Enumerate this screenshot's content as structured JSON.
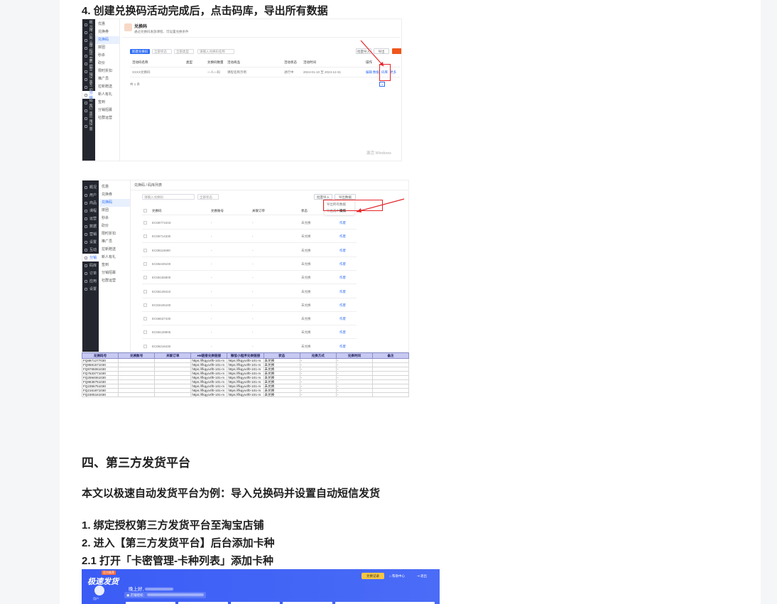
{
  "step4": "4. 创建兑换码活动完成后，点击码库，导出所有数据",
  "section4": "四、第三方发货平台",
  "intro": "本文以极速自动发货平台为例：导入兑换码并设置自动短信发货",
  "step1": "1. 绑定授权第三方发货平台至淘宝店铺",
  "step2": "2. 进入【第三方发货平台】后台添加卡种",
  "step21": "2.1 打开「卡密管理-卡种列表」添加卡种",
  "shot1": {
    "nav": [
      "概况",
      "用户",
      "商品",
      "课程",
      "运营",
      "数据",
      "营销",
      "设置",
      "互动",
      "分销",
      "码库",
      "订单",
      "应用",
      "设置"
    ],
    "sub": [
      "优惠",
      "兑换券",
      "兑换码",
      "拼团",
      "秒杀",
      "砍价",
      "限时折扣",
      "推广员",
      "拉新赠送",
      "新人有礼",
      "签到",
      "分销招募",
      "社群运营"
    ],
    "title": "兑换码",
    "desc": "通过兑换码发放课程、可设置兑换条件",
    "create": "新建兑换码",
    "filter1": "全部状态",
    "filter2": "全部类型",
    "search": "请输入兑换码名称",
    "btn_a": "批量导入",
    "btn_b": "导出",
    "cols": [
      "活动码名称",
      "类型",
      "兑换码数量",
      "活动商品",
      "活动状态",
      "活动时间",
      "操作"
    ],
    "row": [
      "XXXX兑换码",
      "",
      "一人一码",
      "课程名称示例",
      "进行中",
      "2024-01-10 至 2024-12-31"
    ],
    "ops": [
      "编辑",
      "数据",
      "码库",
      "更多"
    ],
    "pager": "共 1 条",
    "watermark": "激活 Windows"
  },
  "shot2": {
    "nav": [
      "概况",
      "用户",
      "商品",
      "课程",
      "运营",
      "数据",
      "营销",
      "设置",
      "互动",
      "分销",
      "码库",
      "订单",
      "应用",
      "设置"
    ],
    "sub": [
      "优惠",
      "兑换券",
      "兑换码",
      "拼团",
      "秒杀",
      "砍价",
      "限时折扣",
      "推广员",
      "拉新赠送",
      "新人有礼",
      "签到",
      "分销招募",
      "社群运营"
    ],
    "breadcrumb": "兑换码 / 码库列表",
    "search": "请输入兑换码",
    "status": "全部状态",
    "btn_import": "批量导入",
    "btn_export": "导出数据",
    "menu1": "导出所有数据",
    "menu2": "导出选中数据",
    "cols": [
      "兑换码",
      "兑换账号",
      "关联订单",
      "状态",
      "操作"
    ],
    "codes": [
      "EC88771043",
      "EC85714330",
      "EC88116590",
      "EC86449100",
      "EC85155800",
      "EC85139410",
      "EC83446100",
      "EC86537430",
      "EC86128905",
      "EC86218430"
    ],
    "state": "未兑换",
    "op": "作废"
  },
  "excel": {
    "head": [
      "兑换码号",
      "兑换账号",
      "关联订单",
      "H5链接兑换链接",
      "微信小程序兑换链接",
      "状态",
      "兑换方式",
      "兑换时间",
      "备注"
    ],
    "rows": [
      [
        "FQ8871277030",
        "",
        "",
        "https://fkqyo4f0-101-m",
        "https://fkqyo4f0-101-m",
        "未兑换",
        "-",
        "-",
        ""
      ],
      [
        "FQ8581571030",
        "",
        "",
        "https://fkqyo4f0-101-m",
        "https://fkqyo4f0-101-m",
        "未兑换",
        "-",
        "-",
        ""
      ],
      [
        "FQ8765061030",
        "",
        "",
        "https://fkqyo4f0-101-m",
        "https://fkqyo4f0-101-m",
        "未兑换",
        "-",
        "-",
        ""
      ],
      [
        "FQ7533771030",
        "",
        "",
        "https://fkqyo4f0-101-m",
        "https://fkqyo4f0-101-m",
        "未兑换",
        "-",
        "-",
        ""
      ],
      [
        "FQ2594061030",
        "",
        "",
        "https://fkqyo4f0-101-m",
        "https://fkqyo4f0-101-m",
        "未兑换",
        "-",
        "-",
        ""
      ],
      [
        "FQ8638751030",
        "",
        "",
        "https://fkqyo4f0-101-m",
        "https://fkqyo4f0-101-m",
        "未兑换",
        "-",
        "-",
        ""
      ],
      [
        "FQ2356751030",
        "",
        "",
        "https://fkqyo4f0-101-m",
        "https://fkqyo4f0-101-m",
        "未兑换",
        "-",
        "-",
        ""
      ],
      [
        "FQ2161871030",
        "",
        "",
        "https://fkqyo4f0-101-m",
        "https://fkqyo4f0-101-m",
        "未兑换",
        "-",
        "-",
        ""
      ],
      [
        "FQ2305161030",
        "",
        "",
        "https://fkqyo4f0-101-m",
        "https://fkqyo4f0-101-m",
        "未兑换",
        "-",
        "-",
        ""
      ]
    ]
  },
  "shot3": {
    "brand": "极速发货",
    "badge": "官方推荐",
    "top_btn1": "兑换记录",
    "top_btn2": "帮助中心",
    "top_btn3": "退出",
    "greeting": "晚上好,",
    "subline": "店铺授权：",
    "avatar_label": "用户"
  }
}
